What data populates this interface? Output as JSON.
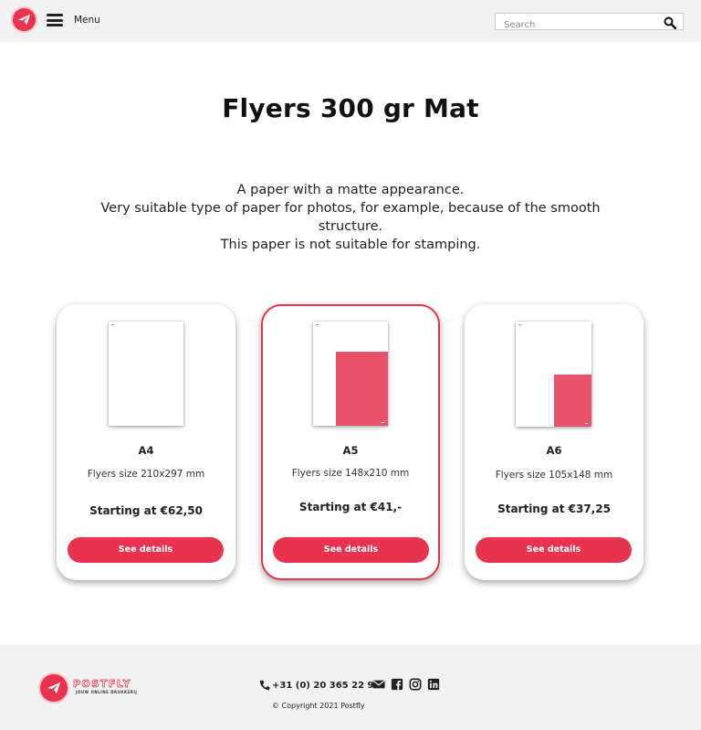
{
  "header": {
    "menu_label": "Menu",
    "search_placeholder": "Search"
  },
  "page": {
    "title": "Flyers 300 gr Mat",
    "description": [
      "A paper with a matte appearance.",
      "Very suitable type of paper for photos, for example, because of the smooth structure.",
      "This paper is not suitable for stamping."
    ]
  },
  "products": [
    {
      "size": "A4",
      "desc": "Flyers size 210x297 mm",
      "price": "Starting at €62,50",
      "button": "See details",
      "fill_fraction": 0.0,
      "selected": false
    },
    {
      "size": "A5",
      "desc": "Flyers size 148x210 mm",
      "price": "Starting at €41,-",
      "button": "See details",
      "fill_fraction": 0.5,
      "selected": true
    },
    {
      "size": "A6",
      "desc": "Flyers size 105x148 mm",
      "price": "Starting at €37,25",
      "button": "See details",
      "fill_fraction": 0.25,
      "selected": false
    }
  ],
  "footer": {
    "brand": "POSTFLY",
    "tagline": "JOUW ONLINE DRUKKERIJ",
    "phone": "+31 (0) 20 365 22 93",
    "copyright": "© Copyright 2021 Postfly",
    "social_icons": [
      "envelope-icon",
      "facebook-icon",
      "instagram-icon",
      "linkedin-icon"
    ]
  },
  "colors": {
    "accent": "#e8334f",
    "paper_fill": "#e8526a",
    "header_bg": "#f2f2f2"
  }
}
